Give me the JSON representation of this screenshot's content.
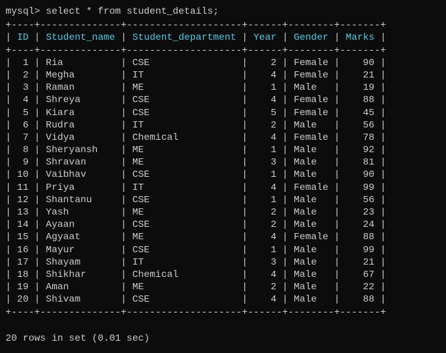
{
  "prompt": "mysql>",
  "query": "select * from student_details;",
  "columns": [
    "ID",
    "Student_name",
    "Student_department",
    "Year",
    "Gender",
    "Marks"
  ],
  "chart_data": {
    "type": "table",
    "columns": [
      "ID",
      "Student_name",
      "Student_department",
      "Year",
      "Gender",
      "Marks"
    ],
    "rows": [
      {
        "ID": 1,
        "Student_name": "Ria",
        "Student_department": "CSE",
        "Year": 2,
        "Gender": "Female",
        "Marks": 90
      },
      {
        "ID": 2,
        "Student_name": "Megha",
        "Student_department": "IT",
        "Year": 4,
        "Gender": "Female",
        "Marks": 21
      },
      {
        "ID": 3,
        "Student_name": "Raman",
        "Student_department": "ME",
        "Year": 1,
        "Gender": "Male",
        "Marks": 19
      },
      {
        "ID": 4,
        "Student_name": "Shreya",
        "Student_department": "CSE",
        "Year": 4,
        "Gender": "Female",
        "Marks": 88
      },
      {
        "ID": 5,
        "Student_name": "Kiara",
        "Student_department": "CSE",
        "Year": 5,
        "Gender": "Female",
        "Marks": 45
      },
      {
        "ID": 6,
        "Student_name": "Rudra",
        "Student_department": "IT",
        "Year": 2,
        "Gender": "Male",
        "Marks": 56
      },
      {
        "ID": 7,
        "Student_name": "Vidya",
        "Student_department": "Chemical",
        "Year": 4,
        "Gender": "Female",
        "Marks": 78
      },
      {
        "ID": 8,
        "Student_name": "Sheryansh",
        "Student_department": "ME",
        "Year": 1,
        "Gender": "Male",
        "Marks": 92
      },
      {
        "ID": 9,
        "Student_name": "Shravan",
        "Student_department": "ME",
        "Year": 3,
        "Gender": "Male",
        "Marks": 81
      },
      {
        "ID": 10,
        "Student_name": "Vaibhav",
        "Student_department": "CSE",
        "Year": 1,
        "Gender": "Male",
        "Marks": 90
      },
      {
        "ID": 11,
        "Student_name": "Priya",
        "Student_department": "IT",
        "Year": 4,
        "Gender": "Female",
        "Marks": 99
      },
      {
        "ID": 12,
        "Student_name": "Shantanu",
        "Student_department": "CSE",
        "Year": 1,
        "Gender": "Male",
        "Marks": 56
      },
      {
        "ID": 13,
        "Student_name": "Yash",
        "Student_department": "ME",
        "Year": 2,
        "Gender": "Male",
        "Marks": 23
      },
      {
        "ID": 14,
        "Student_name": "Ayaan",
        "Student_department": "CSE",
        "Year": 2,
        "Gender": "Male",
        "Marks": 24
      },
      {
        "ID": 15,
        "Student_name": "Agyaat",
        "Student_department": "ME",
        "Year": 4,
        "Gender": "Female",
        "Marks": 88
      },
      {
        "ID": 16,
        "Student_name": "Mayur",
        "Student_department": "CSE",
        "Year": 1,
        "Gender": "Male",
        "Marks": 99
      },
      {
        "ID": 17,
        "Student_name": "Shayam",
        "Student_department": "IT",
        "Year": 3,
        "Gender": "Male",
        "Marks": 21
      },
      {
        "ID": 18,
        "Student_name": "Shikhar",
        "Student_department": "Chemical",
        "Year": 4,
        "Gender": "Male",
        "Marks": 67
      },
      {
        "ID": 19,
        "Student_name": "Aman",
        "Student_department": "ME",
        "Year": 2,
        "Gender": "Male",
        "Marks": 22
      },
      {
        "ID": 20,
        "Student_name": "Shivam",
        "Student_department": "CSE",
        "Year": 4,
        "Gender": "Male",
        "Marks": 88
      }
    ]
  },
  "status": "20 rows in set (0.01 sec)",
  "border_top": "+----+--------------+--------------------+------+--------+-------+",
  "col_widths": {
    "ID": 4,
    "Student_name": 14,
    "Student_department": 20,
    "Year": 6,
    "Gender": 8,
    "Marks": 7
  }
}
